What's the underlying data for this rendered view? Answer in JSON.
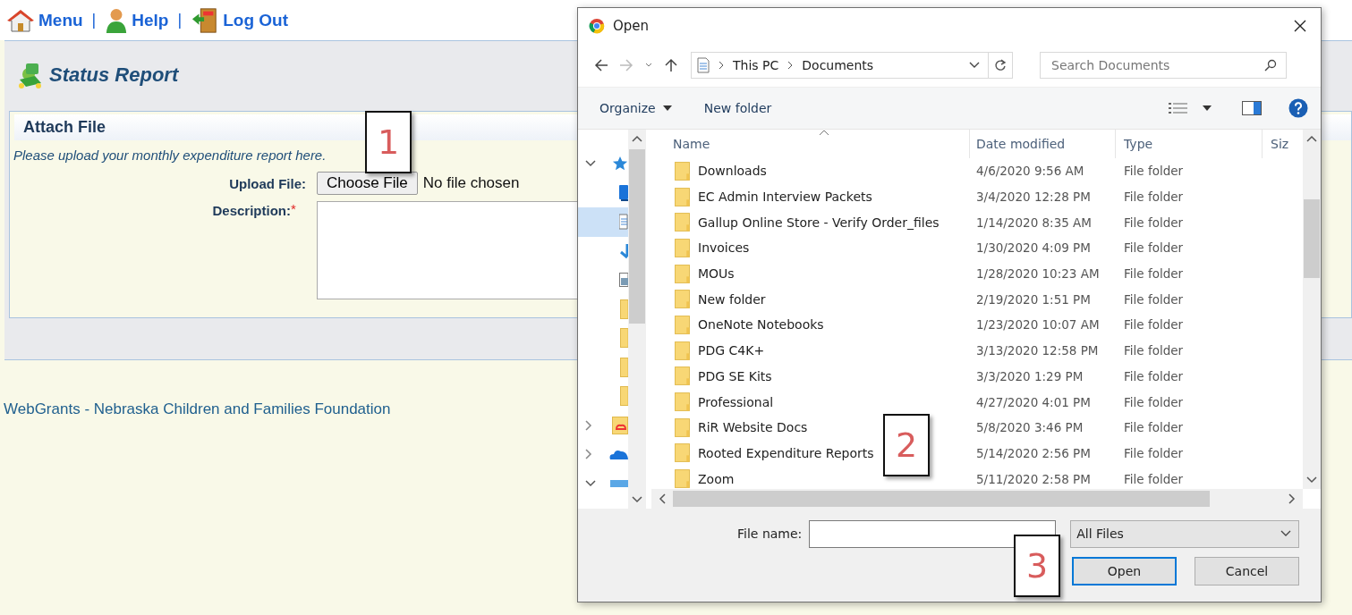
{
  "nav_links": [
    {
      "label": "Menu",
      "kind": "home"
    },
    {
      "label": "Help",
      "kind": "person",
      "separator_before": "|"
    },
    {
      "label": "Log Out",
      "kind": "exit",
      "separator_before": "|"
    }
  ],
  "page": {
    "title": "Status Report",
    "section": "Attach File",
    "instructions": "Please upload your monthly expenditure report here.",
    "upload_label": "Upload File:",
    "choose_button": "Choose File",
    "file_status": "No file chosen",
    "description_label": "Description:",
    "required_mark": "*",
    "footer": "WebGrants - Nebraska Children and Families Foundation"
  },
  "callouts": [
    "1",
    "2",
    "3"
  ],
  "dialog": {
    "title": "Open",
    "breadcrumbs": [
      "This PC",
      "Documents"
    ],
    "search_placeholder": "Search Documents",
    "toolbar": [
      "Organize",
      "New folder"
    ],
    "nav_items": [
      {
        "kind": "quick-access",
        "expandable": true,
        "expanded": true,
        "selected": false
      },
      {
        "kind": "desktop",
        "expandable": false,
        "expanded": false,
        "selected": false
      },
      {
        "kind": "documents",
        "expandable": false,
        "expanded": false,
        "selected": true
      },
      {
        "kind": "downloads",
        "expandable": false,
        "expanded": false,
        "selected": false
      },
      {
        "kind": "pictures",
        "expandable": false,
        "expanded": false,
        "selected": false
      },
      {
        "kind": "folder",
        "expandable": false,
        "expanded": false,
        "selected": false
      },
      {
        "kind": "folder",
        "expandable": false,
        "expanded": false,
        "selected": false
      },
      {
        "kind": "folder",
        "expandable": false,
        "expanded": false,
        "selected": false
      },
      {
        "kind": "folder",
        "expandable": false,
        "expanded": false,
        "selected": false
      },
      {
        "kind": "cloud-files",
        "expandable": true,
        "expanded": false,
        "selected": false
      },
      {
        "kind": "onedrive",
        "expandable": true,
        "expanded": false,
        "selected": false
      },
      {
        "kind": "computer",
        "expandable": true,
        "expanded": true,
        "selected": false
      }
    ],
    "columns": [
      "Name",
      "Date modified",
      "Type",
      "Siz"
    ],
    "rows": [
      {
        "name": "Downloads",
        "date": "4/6/2020 9:56 AM",
        "type": "File folder"
      },
      {
        "name": "EC Admin Interview Packets",
        "date": "3/4/2020 12:28 PM",
        "type": "File folder"
      },
      {
        "name": "Gallup Online Store - Verify Order_files",
        "date": "1/14/2020 8:35 AM",
        "type": "File folder"
      },
      {
        "name": "Invoices",
        "date": "1/30/2020 4:09 PM",
        "type": "File folder"
      },
      {
        "name": "MOUs",
        "date": "1/28/2020 10:23 AM",
        "type": "File folder"
      },
      {
        "name": "New folder",
        "date": "2/19/2020 1:51 PM",
        "type": "File folder"
      },
      {
        "name": "OneNote Notebooks",
        "date": "1/23/2020 10:07 AM",
        "type": "File folder"
      },
      {
        "name": "PDG C4K+",
        "date": "3/13/2020 12:58 PM",
        "type": "File folder"
      },
      {
        "name": "PDG SE Kits",
        "date": "3/3/2020 1:29 PM",
        "type": "File folder"
      },
      {
        "name": "Professional",
        "date": "4/27/2020 4:01 PM",
        "type": "File folder"
      },
      {
        "name": "RiR Website Docs",
        "date": "5/8/2020 3:46 PM",
        "type": "File folder"
      },
      {
        "name": "Rooted Expenditure Reports",
        "date": "5/14/2020 2:56 PM",
        "type": "File folder"
      },
      {
        "name": "Zoom",
        "date": "5/11/2020 2:58 PM",
        "type": "File folder"
      }
    ],
    "file_name_label": "File name:",
    "filter": "All Files",
    "buttons": [
      "Open",
      "Cancel"
    ]
  }
}
